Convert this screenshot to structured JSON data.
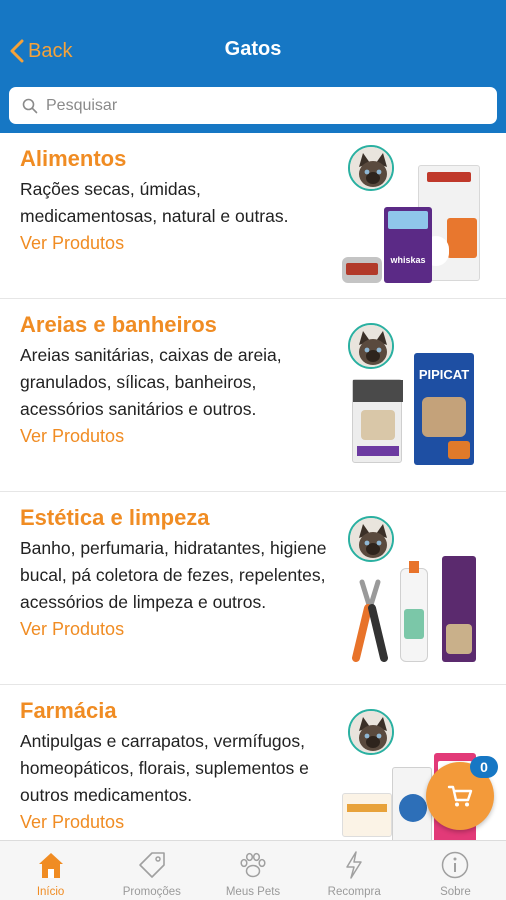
{
  "header": {
    "back_label": "Back",
    "title": "Gatos",
    "search_placeholder": "Pesquisar"
  },
  "categories": [
    {
      "title": "Alimentos",
      "description": "Rações secas, úmidas, medicamentosas, natural e outras.",
      "link": "Ver Produtos"
    },
    {
      "title": "Areias e banheiros",
      "description": "Areias sanitárias, caixas de areia, granulados, sílicas, banheiros, acessórios sanitários e outros.",
      "link": "Ver Produtos"
    },
    {
      "title": "Estética e limpeza",
      "description": "Banho, perfumaria, hidratantes, higiene bucal, pá coletora de fezes, repelentes, acessórios de limpeza e outros.",
      "link": "Ver Produtos"
    },
    {
      "title": "Farmácia",
      "description": "Antipulgas e carrapatos, vermífugos, homeopáticos, florais, suplementos e outros medicamentos.",
      "link": "Ver Produtos"
    }
  ],
  "product_labels": {
    "pipicat": "PIPICAT",
    "whiskas": "whiskas"
  },
  "cart": {
    "count": "0"
  },
  "tabbar": {
    "items": [
      {
        "label": "Início",
        "icon": "home-icon",
        "active": true
      },
      {
        "label": "Promoções",
        "icon": "tag-icon",
        "active": false
      },
      {
        "label": "Meus Pets",
        "icon": "paw-icon",
        "active": false
      },
      {
        "label": "Recompra",
        "icon": "bolt-icon",
        "active": false
      },
      {
        "label": "Sobre",
        "icon": "info-icon",
        "active": false
      }
    ]
  },
  "colors": {
    "header": "#1677c4",
    "accent": "#f08c23",
    "avatar_ring": "#2ab0a1",
    "fab": "#f39a3a"
  }
}
